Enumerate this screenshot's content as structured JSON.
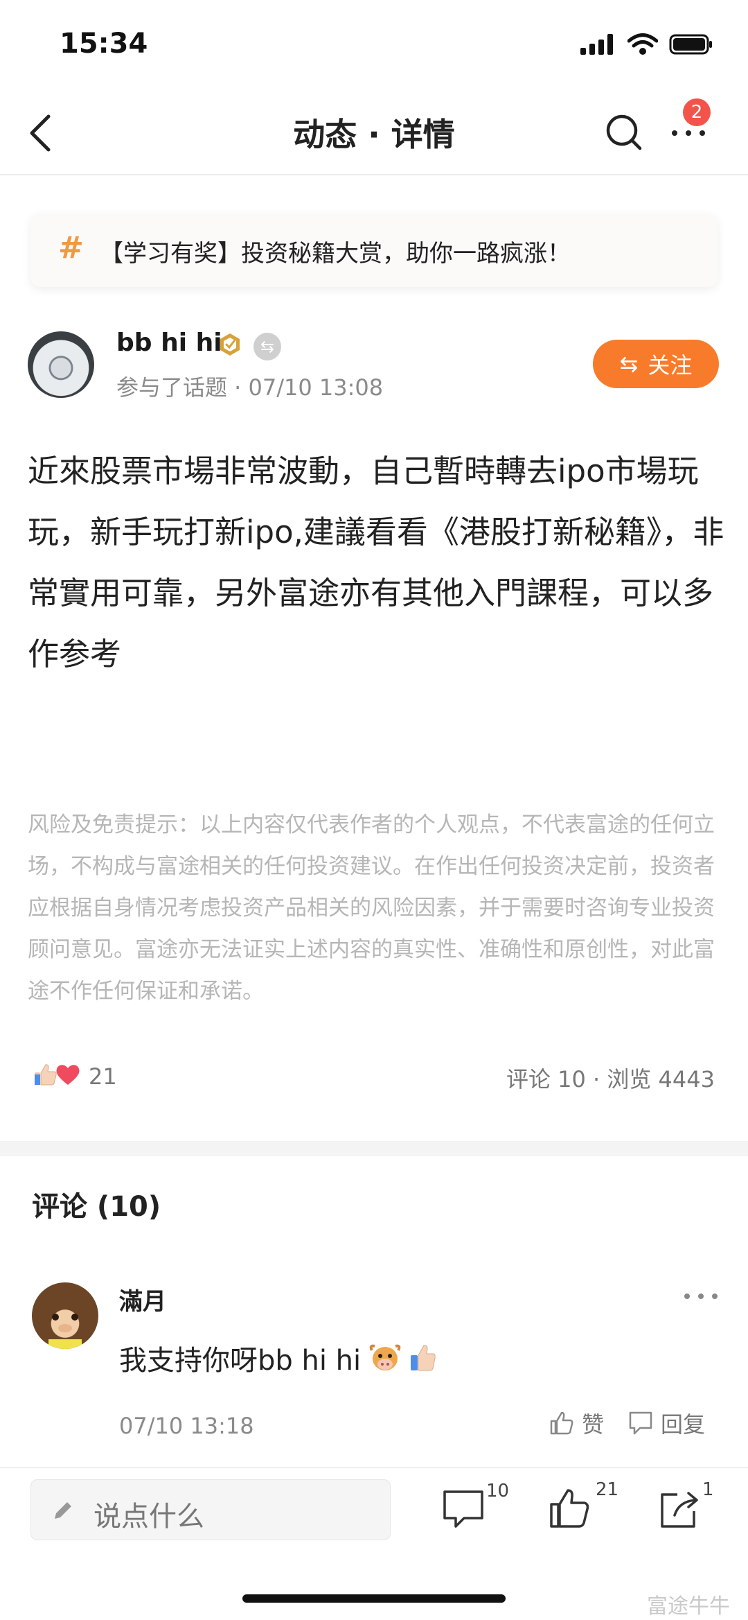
{
  "status_bar": {
    "time": "15:34"
  },
  "nav": {
    "title": "动态 · 详情",
    "badge": "2"
  },
  "topic": {
    "hash": "#",
    "text": "【学习有奖】投资秘籍大赏，助你一路疯涨！"
  },
  "author": {
    "name": "bb hi hi",
    "repost_glyph": "⇆",
    "meta": "参与了话题 · 07/10 13:08",
    "follow_label": "关注",
    "follow_icon": "⇆"
  },
  "post": {
    "body": "近來股票市場非常波動，自己暫時轉去ipo市場玩玩，新手玩打新ipo,建議看看《港股打新秘籍》，非常實用可靠，另外富途亦有其他入門課程，可以多作参考",
    "disclaimer": "风险及免责提示：以上内容仅代表作者的个人观点，不代表富途的任何立场，不构成与富途相关的任何投资建议。在作出任何投资决定前，投资者应根据自身情况考虑投资产品相关的风险因素，并于需要时咨询专业投资顾问意见。富途亦无法证实上述内容的真实性、准确性和原创性，对此富途不作任何保证和承诺。"
  },
  "stats": {
    "likes": "21",
    "summary": "评论 10 · 浏览 4443"
  },
  "comments": {
    "title": "评论 (10)",
    "items": [
      {
        "user": "滿月",
        "text": "我支持你呀bb hi hi",
        "time": "07/10 13:18",
        "like_label": "赞",
        "reply_label": "回复"
      }
    ]
  },
  "bottom_bar": {
    "placeholder": "说点什么",
    "comment_count": "10",
    "like_count": "21",
    "share_count": "1"
  },
  "watermark": "富途牛牛",
  "colors": {
    "accent": "#f77b2b",
    "badge": "#f2544b",
    "topic_hash": "#f09a3d"
  },
  "icons": [
    "back-icon",
    "search-icon",
    "more-icon",
    "verified-icon",
    "thumbs-up-icon",
    "heart-icon",
    "comment-icon",
    "share-icon",
    "pencil-icon",
    "cow-emoji-icon"
  ]
}
